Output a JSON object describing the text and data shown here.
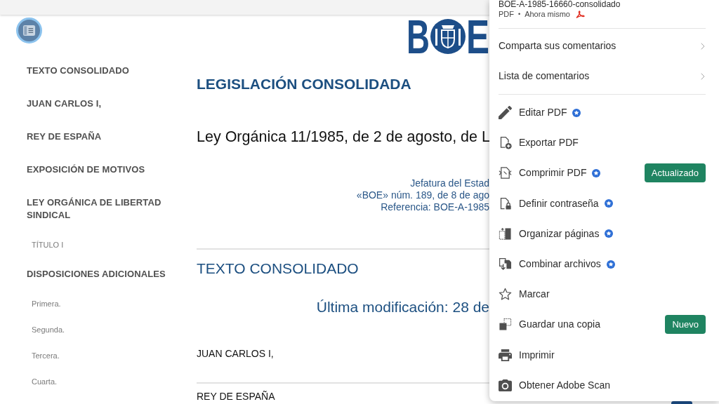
{
  "sidebar": {
    "items": [
      {
        "label": "TEXTO CONSOLIDADO"
      },
      {
        "label": "JUAN CARLOS I,"
      },
      {
        "label": "REY DE ESPAÑA"
      },
      {
        "label": "EXPOSICIÓN DE MOTIVOS"
      },
      {
        "label": "LEY ORGÁNICA DE LIBERTAD SINDICAL",
        "children": [
          {
            "label": "TÍTULO I"
          }
        ]
      },
      {
        "label": "DISPOSICIONES ADICIONALES",
        "children": [
          {
            "label": "Primera."
          },
          {
            "label": "Segunda."
          },
          {
            "label": "Tercera."
          },
          {
            "label": "Cuarta."
          }
        ]
      }
    ]
  },
  "document": {
    "logo": {
      "letters": [
        "B",
        "E"
      ]
    },
    "heading": "LEGISLACIÓN CONSOLIDADA",
    "law_title": "Ley Orgánica 11/1985, de 2 de agosto, de L",
    "publication_lines": [
      "Jefatura del Estad",
      "«BOE» núm. 189, de 8 de ago",
      "Referencia: BOE-A-1985"
    ],
    "section_title": "TEXTO CONSOLIDADO",
    "last_modified": "Última modificación: 28 de",
    "paragraphs": [
      "JUAN CARLOS I,",
      "REY DE ESPAÑA"
    ]
  },
  "menu": {
    "file_name": "BOE-A-1985-16660-consolidado",
    "file_type": "PDF",
    "separator": "•",
    "file_time": "Ahora mismo",
    "submenus": [
      {
        "label": "Comparta sus comentarios"
      },
      {
        "label": "Lista de comentarios"
      }
    ],
    "actions": [
      {
        "label": "Editar PDF",
        "premium": true
      },
      {
        "label": "Exportar PDF",
        "premium": false
      },
      {
        "label": "Comprimir PDF",
        "premium": true,
        "badge": "Actualizado"
      },
      {
        "label": "Definir contraseña",
        "premium": true
      },
      {
        "label": "Organizar páginas",
        "premium": true
      },
      {
        "label": "Combinar archivos",
        "premium": true
      },
      {
        "label": "Marcar",
        "premium": false
      },
      {
        "label": "Guardar una copia",
        "premium": false,
        "badge": "Nuevo"
      },
      {
        "label": "Imprimir",
        "premium": false
      },
      {
        "label": "Obtener Adobe Scan",
        "premium": false
      }
    ]
  }
}
